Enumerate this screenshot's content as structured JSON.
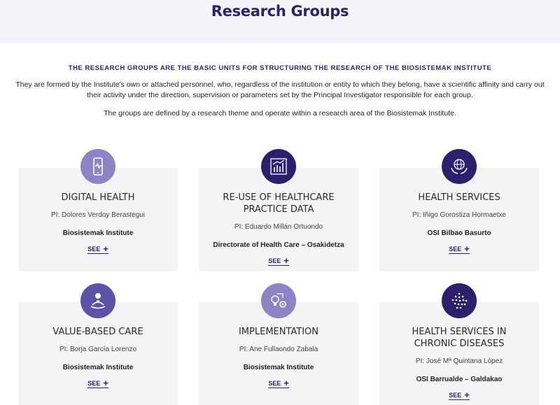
{
  "page": {
    "title": "Research Groups"
  },
  "intro": {
    "tagline": "THE RESEARCH GROUPS ARE THE BASIC UNITS FOR STRUCTURING THE RESEARCH OF THE BIOSISTEMAK INSTITUTE",
    "paragraph1": "They are formed by the Institute's own or attached personnel, who, regardless of the institution or entity to which they belong, have a scientific affinity and carry out their activity under the direction, supervision or parameters set by the Principal Investigator responsible for each group.",
    "paragraph2": "The groups are defined by a research theme and operate within a research area of the Biosistemak Institute."
  },
  "colors": {
    "dark_purple": "#2d1f6e",
    "light_purple": "#8c84c4"
  },
  "groups": [
    {
      "title": "DIGITAL HEALTH",
      "pi": "PI: Dolores Verdoy Berastegui",
      "institution": "Biosistemak Institute",
      "see_label": "SEE",
      "plus": "+",
      "icon": "phone-heart-icon"
    },
    {
      "title": "RE-USE OF HEALTHCARE PRACTICE DATA",
      "pi": "PI: Eduardo Millán Ortuondo",
      "institution": "Directorate of Health Care – Osakidetza",
      "see_label": "SEE",
      "plus": "+",
      "icon": "bar-chart-icon"
    },
    {
      "title": "HEALTH SERVICES",
      "pi": "PI: Iñigo Gorostiza Hormaetxe",
      "institution": "OSI Bilbao Basurto",
      "see_label": "SEE",
      "plus": "+",
      "icon": "globe-hands-icon"
    },
    {
      "title": "VALUE-BASED CARE",
      "pi": "PI: Borja García Lorenzo",
      "institution": "Biosistemak Institute",
      "see_label": "SEE",
      "plus": "+",
      "icon": "person-care-icon"
    },
    {
      "title": "IMPLEMENTATION",
      "pi": "PI: Ane Fullaondo Zabala",
      "institution": "Biosistemak Institute",
      "see_label": "SEE",
      "plus": "+",
      "icon": "lightbulb-gear-icon"
    },
    {
      "title": "HEALTH SERVICES IN CHRONIC DISEASES",
      "pi": "PI: José Mª Quintana López",
      "institution": "OSI Barrualde – Galdakao",
      "see_label": "SEE",
      "plus": "+",
      "icon": "dots-network-icon"
    }
  ]
}
